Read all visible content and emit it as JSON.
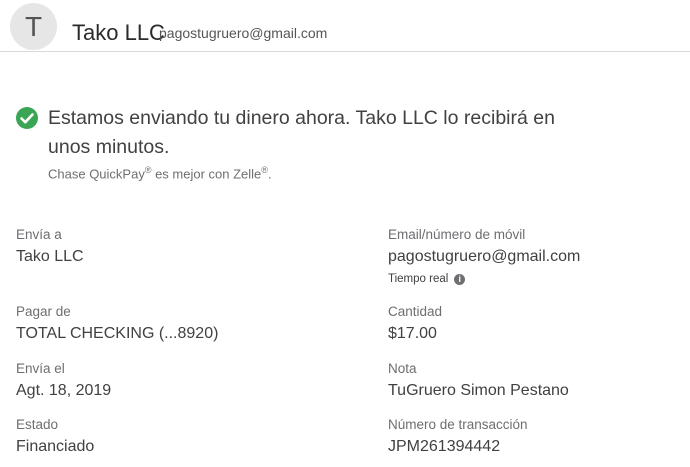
{
  "header": {
    "avatar_letter": "T",
    "name": "Tako LLC",
    "email": "pagostugruero@gmail.com"
  },
  "confirmation": {
    "message": "Estamos enviando tu dinero ahora. Tako LLC lo recibirá en unos minutos.",
    "note_prefix": "Chase QuickPay",
    "note_mid": " es mejor con Zelle",
    "note_suffix": ".",
    "reg_mark": "®",
    "success_color": "#3aa655",
    "icon": "check-circle-icon"
  },
  "details": {
    "send_to": {
      "label": "Envía a",
      "value": "Tako LLC"
    },
    "email": {
      "label": "Email/número de móvil",
      "value": "pagostugruero@gmail.com",
      "note": "Tiempo real",
      "note_icon": "info-icon"
    },
    "pay_from": {
      "label": "Pagar de",
      "value": "TOTAL CHECKING (...8920)"
    },
    "amount": {
      "label": "Cantidad",
      "value": "$17.00"
    },
    "send_on": {
      "label": "Envía el",
      "value": "Agt. 18, 2019"
    },
    "memo": {
      "label": "Nota",
      "value": "TuGruero Simon Pestano"
    },
    "status": {
      "label": "Estado",
      "value": "Financiado"
    },
    "transaction": {
      "label": "Número de transacción",
      "value": "JPM261394442"
    }
  }
}
